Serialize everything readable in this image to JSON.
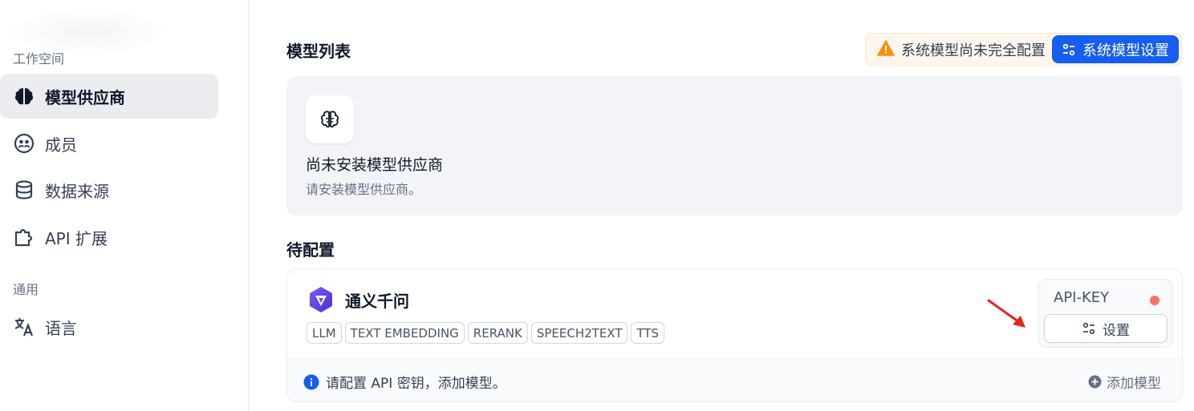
{
  "sidebar": {
    "workspace_label": "工作空间",
    "general_label": "通用",
    "items": [
      {
        "label": "模型供应商",
        "icon": "brain-icon",
        "active": true
      },
      {
        "label": "成员",
        "icon": "members-icon",
        "active": false
      },
      {
        "label": "数据来源",
        "icon": "database-icon",
        "active": false
      },
      {
        "label": "API 扩展",
        "icon": "puzzle-icon",
        "active": false
      }
    ],
    "general_items": [
      {
        "label": "语言",
        "icon": "translate-icon"
      }
    ]
  },
  "main": {
    "title": "模型列表",
    "warning_text": "系统模型尚未完全配置",
    "system_settings_label": "系统模型设置",
    "empty_state": {
      "title": "尚未安装模型供应商",
      "subtitle": "请安装模型供应商。"
    },
    "pending_title": "待配置",
    "provider": {
      "name": "通义千问",
      "tags": [
        "LLM",
        "TEXT EMBEDDING",
        "RERANK",
        "SPEECH2TEXT",
        "TTS"
      ],
      "api_key_label": "API-KEY",
      "setup_label": "设置",
      "info_text": "请配置 API 密钥，添加模型。",
      "add_model_label": "添加模型"
    }
  },
  "colors": {
    "accent": "#155eef",
    "warning": "#f79009",
    "status_dot": "#f97066",
    "annotation_arrow": "#e5241b"
  }
}
